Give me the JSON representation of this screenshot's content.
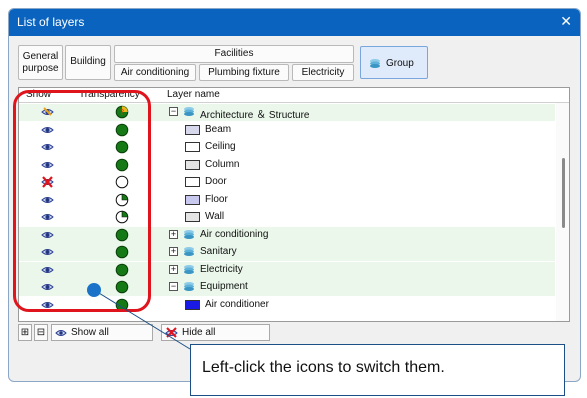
{
  "window": {
    "title": "List of layers",
    "close_glyph": "✕"
  },
  "toolbar": {
    "general": "General purpose",
    "building": "Building",
    "facilities": "Facilities",
    "air_conditioning": "Air conditioning",
    "plumbing_fixture": "Plumbing fixture",
    "electricity": "Electricity",
    "group": "Group"
  },
  "table": {
    "headers": {
      "show": "Show",
      "transparency": "Transparency",
      "layer_name": "Layer name"
    },
    "rows": [
      {
        "label": "Architecture ＆ Structure",
        "kind": "group",
        "expander": "⊟",
        "show": "partial",
        "transparency": "mixed"
      },
      {
        "label": "Beam",
        "kind": "layer",
        "swatch": "#d8d8ec",
        "show": "visible",
        "transparency": "solid"
      },
      {
        "label": "Ceiling",
        "kind": "layer",
        "swatch": "#ffffff",
        "show": "visible",
        "transparency": "solid"
      },
      {
        "label": "Column",
        "kind": "layer",
        "swatch": "#e4e4e4",
        "show": "visible",
        "transparency": "solid"
      },
      {
        "label": "Door",
        "kind": "layer",
        "swatch": "#ffffff",
        "show": "hidden",
        "transparency": "empty"
      },
      {
        "label": "Floor",
        "kind": "layer",
        "swatch": "#c9c9f0",
        "show": "visible",
        "transparency": "quarter"
      },
      {
        "label": "Wall",
        "kind": "layer",
        "swatch": "#e4e4e4",
        "show": "visible",
        "transparency": "quarter"
      },
      {
        "label": "Air conditioning",
        "kind": "group",
        "expander": "⊞",
        "show": "visible",
        "transparency": "solid"
      },
      {
        "label": "Sanitary",
        "kind": "group",
        "expander": "⊞",
        "show": "visible",
        "transparency": "solid"
      },
      {
        "label": "Electricity",
        "kind": "group",
        "expander": "⊞",
        "show": "visible",
        "transparency": "solid"
      },
      {
        "label": "Equipment",
        "kind": "group",
        "expander": "⊟",
        "show": "visible",
        "transparency": "solid"
      },
      {
        "label": "Air conditioner",
        "kind": "layer",
        "swatch": "#1a1ae6",
        "show": "visible",
        "transparency": "solid"
      }
    ]
  },
  "bottom": {
    "expand_glyph": "⊞",
    "collapse_glyph": "⊟",
    "show_all": "Show all",
    "hide_all": "Hide all"
  },
  "callout": {
    "text": "Left-click the icons to switch them."
  },
  "colors": {
    "title_bar": "#0a64bf",
    "highlight_frame": "#e0141d",
    "group_row": "#eaf7ea",
    "transparency_green": "#157a15"
  }
}
